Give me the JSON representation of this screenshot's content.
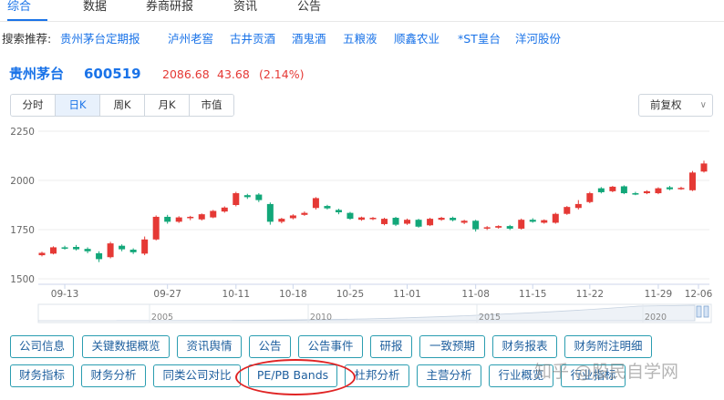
{
  "top_tabs": [
    "综合",
    "数据",
    "券商研报",
    "资讯",
    "公告"
  ],
  "search": {
    "label": "搜索推荐:",
    "links": [
      "贵州茅台定期报",
      "泸州老窖",
      "古井贡酒",
      "酒鬼酒",
      "五粮液",
      "顺鑫农业",
      "*ST皇台",
      "洋河股份"
    ]
  },
  "stock": {
    "name": "贵州茅台",
    "code": "600519",
    "price": "2086.68",
    "change": "43.68",
    "change_pct": "(2.14%)"
  },
  "periods": [
    "分时",
    "日K",
    "周K",
    "月K",
    "市值"
  ],
  "adjust_select": "前复权",
  "chart_data": {
    "type": "candlestick",
    "y_ticks": [
      1500,
      1750,
      2000,
      2250
    ],
    "ylim": [
      1500,
      2250
    ],
    "x_ticks": [
      "09-13",
      "09-27",
      "10-11",
      "10-18",
      "10-25",
      "11-01",
      "11-08",
      "11-15",
      "11-22",
      "11-29",
      "12-06"
    ],
    "navigator_years": [
      "2005",
      "2010",
      "2015",
      "2020"
    ],
    "colors": {
      "up": "#e53935",
      "down": "#12a779",
      "axis": "#999999"
    },
    "candles": [
      {
        "o": 1620,
        "c": 1632,
        "h": 1638,
        "l": 1614
      },
      {
        "o": 1628,
        "c": 1660,
        "h": 1665,
        "l": 1624
      },
      {
        "o": 1660,
        "c": 1655,
        "h": 1668,
        "l": 1648
      },
      {
        "o": 1662,
        "c": 1650,
        "h": 1672,
        "l": 1644
      },
      {
        "o": 1652,
        "c": 1640,
        "h": 1660,
        "l": 1630
      },
      {
        "o": 1630,
        "c": 1600,
        "h": 1640,
        "l": 1585
      },
      {
        "o": 1610,
        "c": 1680,
        "h": 1688,
        "l": 1604
      },
      {
        "o": 1668,
        "c": 1650,
        "h": 1675,
        "l": 1640
      },
      {
        "o": 1648,
        "c": 1635,
        "h": 1655,
        "l": 1626
      },
      {
        "o": 1628,
        "c": 1700,
        "h": 1715,
        "l": 1620
      },
      {
        "o": 1700,
        "c": 1815,
        "h": 1822,
        "l": 1695
      },
      {
        "o": 1815,
        "c": 1790,
        "h": 1825,
        "l": 1780
      },
      {
        "o": 1790,
        "c": 1812,
        "h": 1818,
        "l": 1784
      },
      {
        "o": 1808,
        "c": 1815,
        "h": 1820,
        "l": 1798
      },
      {
        "o": 1802,
        "c": 1828,
        "h": 1832,
        "l": 1796
      },
      {
        "o": 1812,
        "c": 1845,
        "h": 1850,
        "l": 1808
      },
      {
        "o": 1842,
        "c": 1862,
        "h": 1868,
        "l": 1836
      },
      {
        "o": 1875,
        "c": 1935,
        "h": 1942,
        "l": 1868
      },
      {
        "o": 1925,
        "c": 1915,
        "h": 1932,
        "l": 1906
      },
      {
        "o": 1928,
        "c": 1900,
        "h": 1935,
        "l": 1890
      },
      {
        "o": 1880,
        "c": 1790,
        "h": 1888,
        "l": 1775
      },
      {
        "o": 1790,
        "c": 1805,
        "h": 1810,
        "l": 1782
      },
      {
        "o": 1808,
        "c": 1822,
        "h": 1828,
        "l": 1802
      },
      {
        "o": 1825,
        "c": 1835,
        "h": 1842,
        "l": 1820
      },
      {
        "o": 1860,
        "c": 1910,
        "h": 1915,
        "l": 1852
      },
      {
        "o": 1870,
        "c": 1858,
        "h": 1876,
        "l": 1852
      },
      {
        "o": 1850,
        "c": 1838,
        "h": 1856,
        "l": 1828
      },
      {
        "o": 1835,
        "c": 1805,
        "h": 1840,
        "l": 1800
      },
      {
        "o": 1800,
        "c": 1812,
        "h": 1816,
        "l": 1795
      },
      {
        "o": 1805,
        "c": 1810,
        "h": 1814,
        "l": 1798
      },
      {
        "o": 1778,
        "c": 1805,
        "h": 1810,
        "l": 1772
      },
      {
        "o": 1810,
        "c": 1775,
        "h": 1815,
        "l": 1768
      },
      {
        "o": 1780,
        "c": 1800,
        "h": 1806,
        "l": 1774
      },
      {
        "o": 1800,
        "c": 1765,
        "h": 1805,
        "l": 1760
      },
      {
        "o": 1772,
        "c": 1805,
        "h": 1810,
        "l": 1768
      },
      {
        "o": 1800,
        "c": 1810,
        "h": 1815,
        "l": 1795
      },
      {
        "o": 1810,
        "c": 1798,
        "h": 1816,
        "l": 1792
      },
      {
        "o": 1785,
        "c": 1795,
        "h": 1800,
        "l": 1778
      },
      {
        "o": 1795,
        "c": 1752,
        "h": 1800,
        "l": 1740
      },
      {
        "o": 1755,
        "c": 1762,
        "h": 1768,
        "l": 1748
      },
      {
        "o": 1760,
        "c": 1768,
        "h": 1772,
        "l": 1755
      },
      {
        "o": 1768,
        "c": 1755,
        "h": 1774,
        "l": 1748
      },
      {
        "o": 1755,
        "c": 1800,
        "h": 1806,
        "l": 1750
      },
      {
        "o": 1800,
        "c": 1790,
        "h": 1808,
        "l": 1785
      },
      {
        "o": 1785,
        "c": 1798,
        "h": 1802,
        "l": 1780
      },
      {
        "o": 1785,
        "c": 1830,
        "h": 1836,
        "l": 1780
      },
      {
        "o": 1830,
        "c": 1865,
        "h": 1870,
        "l": 1825
      },
      {
        "o": 1860,
        "c": 1880,
        "h": 1900,
        "l": 1852
      },
      {
        "o": 1890,
        "c": 1935,
        "h": 1942,
        "l": 1884
      },
      {
        "o": 1960,
        "c": 1940,
        "h": 1966,
        "l": 1934
      },
      {
        "o": 1945,
        "c": 1968,
        "h": 1972,
        "l": 1940
      },
      {
        "o": 1970,
        "c": 1935,
        "h": 1975,
        "l": 1930
      },
      {
        "o": 1935,
        "c": 1930,
        "h": 1942,
        "l": 1925
      },
      {
        "o": 1935,
        "c": 1945,
        "h": 1950,
        "l": 1930
      },
      {
        "o": 1935,
        "c": 1960,
        "h": 1965,
        "l": 1930
      },
      {
        "o": 1965,
        "c": 1955,
        "h": 1972,
        "l": 1950
      },
      {
        "o": 1958,
        "c": 1962,
        "h": 1968,
        "l": 1952
      },
      {
        "o": 1950,
        "c": 2040,
        "h": 2048,
        "l": 1946
      },
      {
        "o": 2045,
        "c": 2086,
        "h": 2100,
        "l": 2040
      }
    ]
  },
  "buttons_row1": [
    "公司信息",
    "关键数据概览",
    "资讯舆情",
    "公告",
    "公告事件",
    "研报",
    "一致预期",
    "财务报表",
    "财务附注明细"
  ],
  "buttons_row2": [
    "财务指标",
    "财务分析",
    "同类公司对比",
    "PE/PB Bands",
    "杜邦分析",
    "主营分析",
    "行业概览",
    "行业指标"
  ],
  "watermark": "知乎 @股民自学网"
}
